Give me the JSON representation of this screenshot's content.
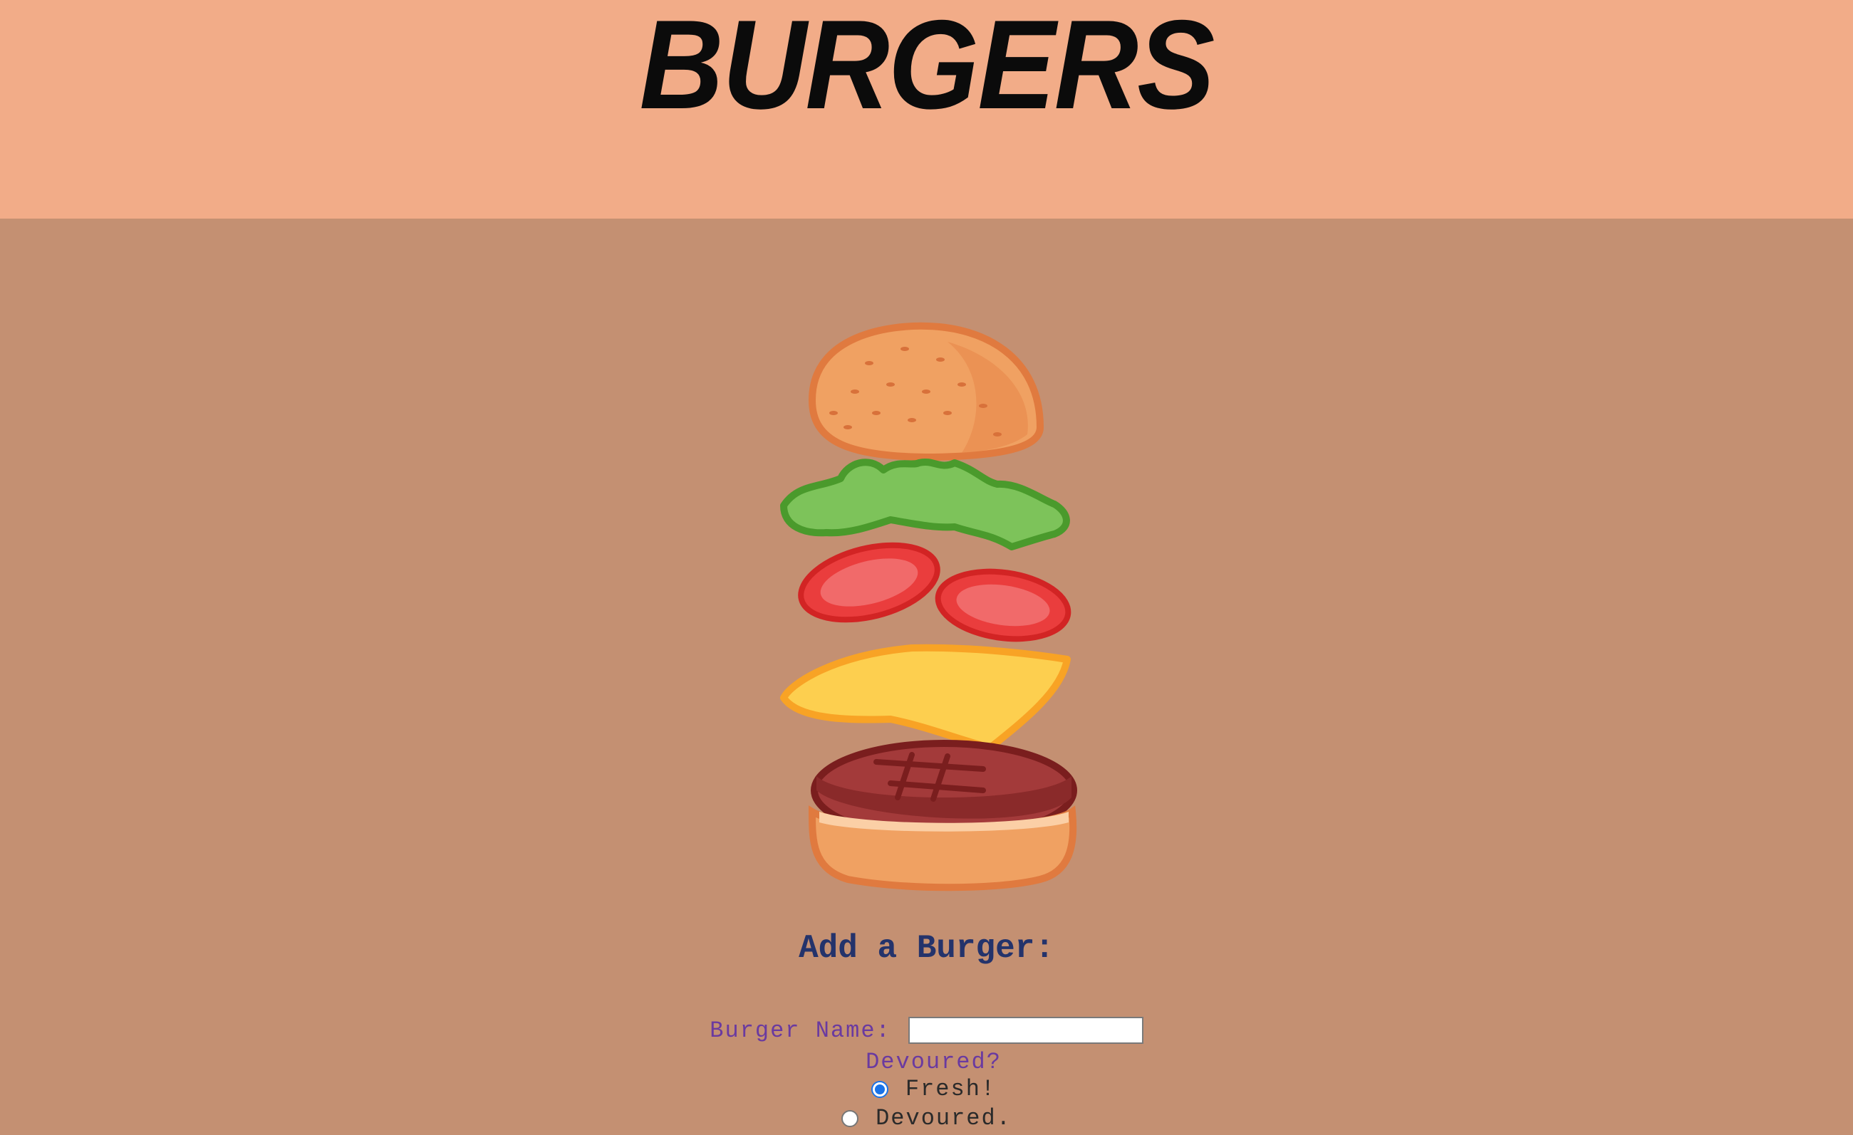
{
  "header": {
    "title": "BURGERS"
  },
  "illustration": {
    "icon": "burger-illustration"
  },
  "form": {
    "heading": "Add a Burger:",
    "name_label": "Burger Name:",
    "name_value": "",
    "devoured_question": "Devoured?",
    "options": [
      {
        "label": "Fresh!",
        "selected": true
      },
      {
        "label": "Devoured.",
        "selected": false
      }
    ]
  },
  "colors": {
    "header_bg": "#f2ac88",
    "page_bg": "#c49072",
    "heading": "#24336b",
    "label": "#6a3aa0"
  }
}
